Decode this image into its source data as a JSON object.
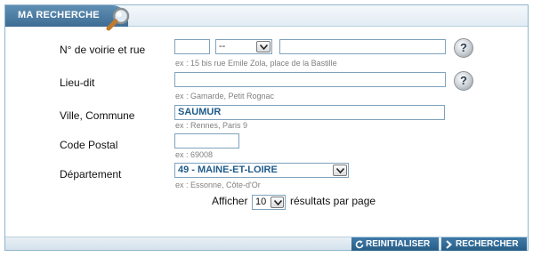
{
  "header": {
    "title": "MA RECHERCHE"
  },
  "fields": {
    "voirie": {
      "label": "N° de voirie et rue",
      "number_value": "",
      "suffix_value": "--",
      "street_value": "",
      "hint": "ex : 15 bis rue Emile Zola, place de la Bastille"
    },
    "lieudit": {
      "label": "Lieu-dit",
      "value": "",
      "hint": "ex : Gamarde, Petit Rognac"
    },
    "ville": {
      "label": "Ville, Commune",
      "value": "SAUMUR",
      "hint": "ex : Rennes, Paris 9"
    },
    "codepostal": {
      "label": "Code Postal",
      "value": "",
      "hint": "ex : 69008"
    },
    "departement": {
      "label": "Département",
      "value": "49 - MAINE-ET-LOIRE",
      "hint": "ex : Essonne, Côte-d'Or"
    }
  },
  "pagination": {
    "before": "Afficher",
    "per_page": "10",
    "after": "résultats par page"
  },
  "help": {
    "symbol": "?"
  },
  "footer": {
    "reset_label": "REINITIALISER",
    "search_label": "RECHERCHER"
  },
  "icons": {
    "header": "magnifier-icon",
    "reset": "refresh-icon",
    "search": "chevron-right-icon",
    "help": "help-icon"
  }
}
